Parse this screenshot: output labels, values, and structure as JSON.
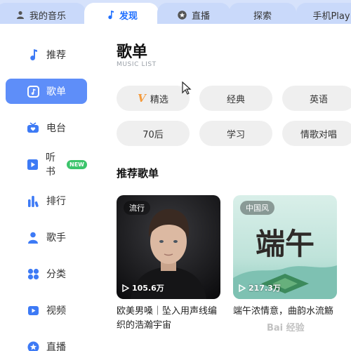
{
  "tabs": [
    {
      "label": "我的音乐",
      "icon": "user-icon"
    },
    {
      "label": "发现",
      "icon": "music-note-icon",
      "active": true
    },
    {
      "label": "直播",
      "icon": "star-icon"
    },
    {
      "label": "探索"
    },
    {
      "label": "手机Play"
    }
  ],
  "sidebar": {
    "items": [
      {
        "label": "推荐",
        "icon": "music-note-icon"
      },
      {
        "label": "歌单",
        "icon": "playlist-icon",
        "active": true
      },
      {
        "label": "电台",
        "icon": "radio-icon"
      },
      {
        "label": "听书",
        "icon": "audiobook-icon",
        "badge": "NEW"
      },
      {
        "label": "排行",
        "icon": "chart-bars-icon"
      },
      {
        "label": "歌手",
        "icon": "singer-icon"
      },
      {
        "label": "分类",
        "icon": "category-icon"
      },
      {
        "label": "视频",
        "icon": "video-icon"
      },
      {
        "label": "直播",
        "icon": "live-icon"
      }
    ]
  },
  "main": {
    "title": "歌单",
    "subtitle": "MUSIC LIST",
    "filters": [
      {
        "label": "精选",
        "prefix": "V"
      },
      {
        "label": "经典"
      },
      {
        "label": "英语"
      },
      {
        "label": "70后"
      },
      {
        "label": "学习"
      },
      {
        "label": "情歌对唱"
      }
    ],
    "section_title": "推荐歌单",
    "cards": [
      {
        "tag": "流行",
        "plays": "105.6万",
        "caption": "欧美男嗓｜坠入用声线编织的浩瀚宇宙"
      },
      {
        "tag": "中国风",
        "plays": "217.3万",
        "caption": "端午浓情意，曲韵水流觞",
        "art_text": "端午"
      }
    ]
  },
  "watermark": "Bai 经验",
  "colors": {
    "accent": "#1f6fff",
    "sidebar_active": "#5e8ef9",
    "tabbar": "#d6e2fb",
    "new_badge": "#3cc46b",
    "pill_bg": "#efefef"
  }
}
